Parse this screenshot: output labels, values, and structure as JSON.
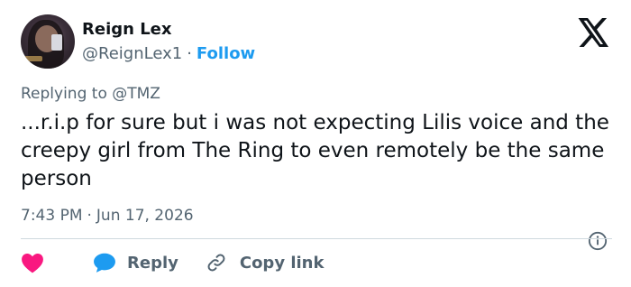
{
  "author": {
    "name": "Reign Lex",
    "handle": "@ReignLex1",
    "separator": "·",
    "follow_label": "Follow"
  },
  "reply_context": {
    "prefix": "Replying to",
    "mention": "@TMZ"
  },
  "tweet": {
    "text": "...r.i.p for sure but i was not expecting Lilis voice and the creepy girl from The Ring to even remotely be the same person",
    "time": "7:43 PM",
    "separator": "·",
    "date": "Jun 17, 2026"
  },
  "actions": {
    "reply_label": "Reply",
    "copy_link_label": "Copy link"
  },
  "icons": {
    "logo": "x-logo-icon",
    "info": "info-icon",
    "like": "heart-icon",
    "reply": "reply-bubble-icon",
    "copy": "link-icon"
  },
  "colors": {
    "accent": "#1d9bf0",
    "like": "#f91880",
    "text": "#0f1419",
    "secondary": "#536471",
    "divider": "#cfd9de"
  }
}
